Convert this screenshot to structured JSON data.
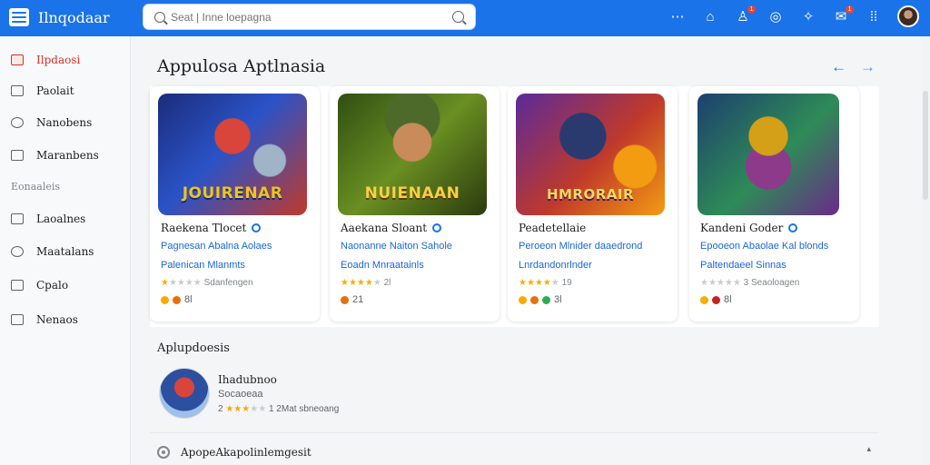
{
  "header": {
    "app_title": "Ilnqodaar",
    "search_placeholder": "Seat | Inne loepagna",
    "notification_badge": "1",
    "messages_badge": "1"
  },
  "sidebar": {
    "items": [
      {
        "label": "Ilpdaosi",
        "icon": "home-icon",
        "active": true
      },
      {
        "label": "Paolait",
        "icon": "library-icon",
        "active": false
      },
      {
        "label": "Nanobens",
        "icon": "search-icon",
        "active": false
      },
      {
        "label": "Maranbens",
        "icon": "calendar-icon",
        "active": false
      }
    ],
    "section_label": "Eonaaleis",
    "section_items": [
      {
        "label": "Laoalnes",
        "icon": "tag-icon"
      },
      {
        "label": "Maatalans",
        "icon": "compass-icon"
      },
      {
        "label": "Cpalo",
        "icon": "lock-icon"
      },
      {
        "label": "Nenaos",
        "icon": "chart-icon"
      }
    ]
  },
  "main": {
    "section_title": "Appulosa Aptlnasia",
    "cards": [
      {
        "banner": "JOUIRENAR",
        "name": "Raekena Tlocet",
        "dev": "Pagnesan Abalna Aolaes",
        "cat": "Palenican Mlanmts",
        "rating_text": "Sdanfengen",
        "stars_on": 1,
        "meta": "8l"
      },
      {
        "banner": "NUIENAAN",
        "name": "Aaekana Sloant",
        "dev": "Naonanne Naiton Sahole",
        "cat": "Eoadn Mnraatainls",
        "rating_text": "2l",
        "stars_on": 4,
        "meta": "21"
      },
      {
        "banner": "HMRORAIR",
        "name": "Peadetellaie",
        "dev": "Peroeon Mlnider daaedrond",
        "cat": "Lnrdandonrlnder",
        "rating_text": "19",
        "stars_on": 4,
        "meta": "3l"
      },
      {
        "banner": "",
        "name": "Kandeni Goder",
        "dev": "Epooeon Abaolae Kal blonds",
        "cat": "Paltendaeel Sinnas",
        "rating_text": "3 Seaoloagen",
        "stars_on": 0,
        "meta": "8l"
      }
    ],
    "apps_title": "Aplupdoesis",
    "app_row": {
      "name": "Ihadubnoo",
      "sub": "Socaoeaa",
      "rating_prefix": "2",
      "rating_text": "1 2Mat sbneoang"
    },
    "footer_row_label": "ApopeAkapolinlemgesit"
  },
  "colors": {
    "accent": "#1a73e8",
    "active": "#d93025",
    "star": "#f9ab00"
  }
}
